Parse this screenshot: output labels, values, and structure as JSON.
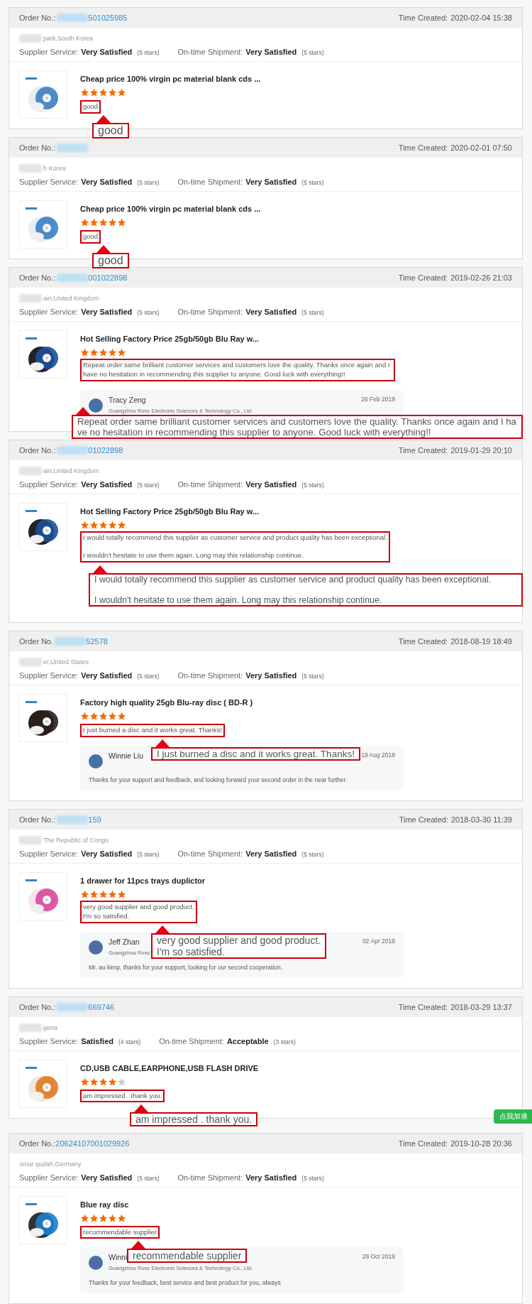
{
  "orders": [
    {
      "order_label": "Order No.:",
      "order_blurred": true,
      "order_number": "501025985",
      "time_label": "Time Created:",
      "time": "2020-02-04 15:38",
      "buyer_blurred": true,
      "location": "park,South Korea",
      "ratings": [
        {
          "label": "Supplier Service:",
          "value": "Very Satisfied",
          "stars_text": "(5 stars)"
        },
        {
          "label": "On-time Shipment:",
          "value": "Very Satisfied",
          "stars_text": "(5 stars)"
        }
      ],
      "product": {
        "title": "Cheap price 100% virgin pc material blank cds ...",
        "stars": 5,
        "review": "good",
        "callout": "good"
      }
    },
    {
      "order_label": "Order No.:",
      "order_blurred": true,
      "time_label": "Time Created:",
      "time": "2020-02-01 07:50",
      "buyer_blurred": true,
      "location": "h Korea",
      "ratings": [
        {
          "label": "Supplier Service:",
          "value": "Very Satisfied",
          "stars_text": "(5 stars)"
        },
        {
          "label": "On-time Shipment:",
          "value": "Very Satisfied",
          "stars_text": "(5 stars)"
        }
      ],
      "product": {
        "title": "Cheap price 100% virgin pc material blank cds ...",
        "stars": 5,
        "review": "good",
        "callout": "good"
      }
    },
    {
      "order_label": "Order No.:",
      "order_blurred": true,
      "order_number": "001022898",
      "time_label": "Time Created:",
      "time": "2019-02-26 21:03",
      "buyer_blurred": true,
      "location": "ain,United Kingdom",
      "ratings": [
        {
          "label": "Supplier Service:",
          "value": "Very Satisfied",
          "stars_text": "(5 stars)"
        },
        {
          "label": "On-time Shipment:",
          "value": "Very Satisfied",
          "stars_text": "(5 stars)"
        }
      ],
      "product": {
        "title": "Hot Selling Factory Price 25gb/50gb Blu Ray w...",
        "stars": 5,
        "review": "Repeat order same brilliant customer services and customers love the quality. Thanks once again and I have no hesitation in recommending this supplier to anyone. Good luck with everything!!",
        "callout": "Repeat order same brilliant customer services and customers love the quality. Thanks once again and I have no hesitation in recommending this supplier to anyone. Good luck with everything!!"
      },
      "reply": {
        "name": "Tracy Zeng",
        "company": "Guangzhou Ronc Electronic Sciences & Technology Co., Ltd.",
        "date": "26 Feb 2019"
      }
    },
    {
      "order_label": "Order No.:",
      "order_blurred": true,
      "order_number": "01022898",
      "time_label": "Time Created:",
      "time": "2019-01-29 20:10",
      "buyer_blurred": true,
      "location": "ain,United Kingdom",
      "ratings": [
        {
          "label": "Supplier Service:",
          "value": "Very Satisfied",
          "stars_text": "(5 stars)"
        },
        {
          "label": "On-time Shipment:",
          "value": "Very Satisfied",
          "stars_text": "(5 stars)"
        }
      ],
      "product": {
        "title": "Hot Selling Factory Price 25gb/50gb Blu Ray w...",
        "stars": 5,
        "review": "I would totally recommend this supplier as customer service and product quality has been exceptional.\n\nI wouldn't hesitate to use them again. Long may this relationship continue.",
        "callout": "I would totally recommend this supplier as customer service and product quality has been exceptional.\n\nI wouldn't hesitate to use them again. Long may this relationship continue."
      }
    },
    {
      "order_label": "Order No.",
      "order_blurred": true,
      "order_number": "52578",
      "time_label": "Time Created:",
      "time": "2018-08-19 18:49",
      "buyer_blurred": true,
      "location": "er,United States",
      "ratings": [
        {
          "label": "Supplier Service:",
          "value": "Very Satisfied",
          "stars_text": "(5 stars)"
        },
        {
          "label": "On-time Shipment:",
          "value": "Very Satisfied",
          "stars_text": "(5 stars)"
        }
      ],
      "product": {
        "title": "Factory high quality 25gb Blu-ray disc ( BD-R )",
        "stars": 5,
        "review": "I just burned a disc and it works great. Thanks!",
        "callout": "I just burned a disc and it works great. Thanks!"
      },
      "reply": {
        "name": "Winnie Liu",
        "date": "19 Aug 2018",
        "message": "Thanks for your support and feedback, and looking forward your second order in the near further."
      }
    },
    {
      "order_label": "Order No.:",
      "order_blurred": true,
      "order_number": "159",
      "time_label": "Time Created:",
      "time": "2018-03-30 11:39",
      "buyer_blurred": true,
      "location": "The Republic of Congo",
      "ratings": [
        {
          "label": "Supplier Service:",
          "value": "Very Satisfied",
          "stars_text": "(5 stars)"
        },
        {
          "label": "On-time Shipment:",
          "value": "Very Satisfied",
          "stars_text": "(5 stars)"
        }
      ],
      "product": {
        "title": "1 drawer for 11pcs trays duplictor",
        "stars": 5,
        "review": "very good supplier and good product.\nI'm so satisfied.",
        "callout": "very good supplier and good product.\nI'm so satisfied."
      },
      "reply": {
        "name": "Jeff Zhan",
        "company": "Guangzhou Ronc",
        "date": "02 Apr 2018",
        "message": "Mr. au kimp, thanks for your support, looking for our second cooperation."
      }
    },
    {
      "order_label": "Order No.:",
      "order_blurred": true,
      "order_number": "669746",
      "time_label": "Time Created:",
      "time": "2018-03-29 13:37",
      "buyer_blurred": true,
      "location": "geria",
      "ratings": [
        {
          "label": "Supplier Service:",
          "value": "Satisfied",
          "stars_text": "(4 stars)"
        },
        {
          "label": "On-time Shipment:",
          "value": "Acceptable",
          "stars_text": "(3 stars)"
        }
      ],
      "product": {
        "title": "CD,USB CABLE,EARPHONE,USB FLASH DRIVE",
        "stars": 4,
        "review": "am impressed . thank you.",
        "callout": "am impressed . thank you."
      }
    },
    {
      "order_label": "Order No.:",
      "order_blurred": false,
      "order_number": "20624107001029926",
      "time_label": "Time Created:",
      "time": "2019-10-28 20:36",
      "buyer_blurred": false,
      "location": "omar qudah,Germany",
      "ratings": [
        {
          "label": "Supplier Service:",
          "value": "Very Satisfied",
          "stars_text": "(5 stars)"
        },
        {
          "label": "On-time Shipment:",
          "value": "Very Satisfied",
          "stars_text": "(5 stars)"
        }
      ],
      "product": {
        "title": "Blue ray disc",
        "stars": 5,
        "review": "recommendable supplier",
        "callout": "recommendable supplier"
      },
      "reply": {
        "name": "Winni",
        "company": "Guangzhou Ronc Electronic Sciences & Technology Co., Ltd.",
        "date": "28 Oct 2019",
        "message": "Thanks for your feedback, best service and best product for you, always"
      }
    }
  ],
  "float_badge": "点我加速"
}
